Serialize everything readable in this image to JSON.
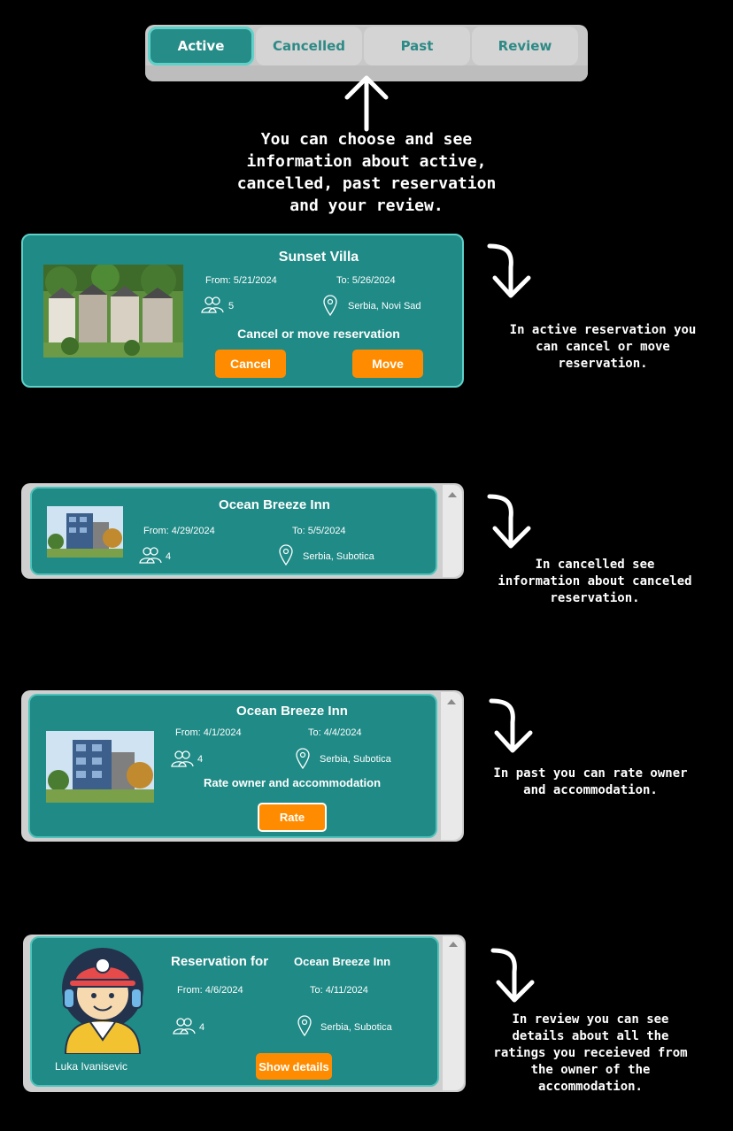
{
  "tabs": {
    "items": [
      {
        "label": "Active"
      },
      {
        "label": "Cancelled"
      },
      {
        "label": "Past"
      },
      {
        "label": "Review"
      }
    ],
    "active_index": 0
  },
  "notes": {
    "tabs_note": "You can choose and see\ninformation about active,\ncancelled, past reservation\nand your review.",
    "active_note": "In active reservation you\ncan cancel or move\nreservation.",
    "cancelled_note": "In cancelled see\ninformation about canceled\nreservation.",
    "past_note": "In past you can rate owner\nand accommodation.",
    "review_note": "In review you can see\ndetails about all the\nratings you receieved from\nthe owner of the\naccommodation."
  },
  "active_card": {
    "name": "Sunset Villa",
    "from": "From: 5/21/2024",
    "to": "To: 5/26/2024",
    "guests": "5",
    "location": "Serbia, Novi Sad",
    "action_text": "Cancel or move reservation",
    "cancel_label": "Cancel",
    "move_label": "Move"
  },
  "cancelled_card": {
    "name": "Ocean Breeze Inn",
    "from": "From: 4/29/2024",
    "to": "To: 5/5/2024",
    "guests": "4",
    "location": "Serbia, Subotica"
  },
  "past_card": {
    "name": "Ocean Breeze Inn",
    "from": "From: 4/1/2024",
    "to": "To: 4/4/2024",
    "guests": "4",
    "location": "Serbia, Subotica",
    "action_text": "Rate owner and accommodation",
    "rate_label": "Rate"
  },
  "review_card": {
    "reservation_for": "Reservation for",
    "name": "Ocean Breeze Inn",
    "from": "From: 4/6/2024",
    "to": "To: 4/11/2024",
    "guests": "4",
    "location": "Serbia, Subotica",
    "user_name": "Luka Ivanisevic",
    "details_label": "Show details"
  },
  "colors": {
    "card": "#1f8a86",
    "accent_button": "#ff8c00",
    "tab_active": "#268c87"
  }
}
